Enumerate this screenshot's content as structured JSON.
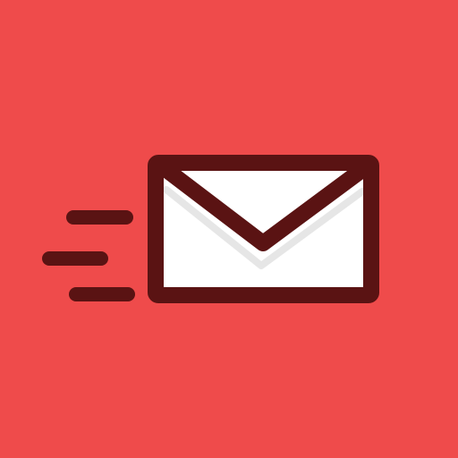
{
  "icon": {
    "name": "sending-mail-icon",
    "background_color": "#EF4B4B",
    "outline_color": "#5A1313",
    "envelope_color": "#FFFFFF",
    "shadow_color": "#E6E6E6"
  }
}
